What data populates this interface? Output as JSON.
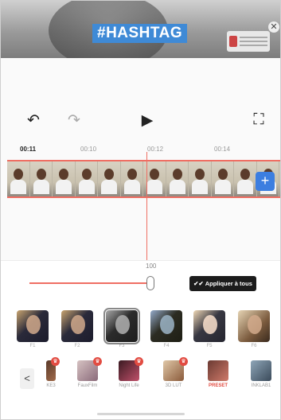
{
  "preview": {
    "hashtag": "#HASHTAG",
    "close_symbol": "✕"
  },
  "controls": {
    "undo": "↶",
    "redo": "↷",
    "play": "▶",
    "fullscreen": "⛶"
  },
  "timeline": {
    "current_time": "00:11",
    "ticks": [
      "00:10",
      "00:12",
      "00:14"
    ],
    "add_symbol": "+"
  },
  "filter_panel": {
    "intensity": "100",
    "apply_all_label": "Appliquer à tous",
    "filters": [
      {
        "label": "F1"
      },
      {
        "label": "F2"
      },
      {
        "label": "F3"
      },
      {
        "label": "F4"
      },
      {
        "label": "F5"
      },
      {
        "label": "F6"
      }
    ],
    "selected_filter": "F3",
    "back_symbol": "<",
    "categories": [
      {
        "label": "KE3",
        "premium": true
      },
      {
        "label": "FauxFilm",
        "premium": true
      },
      {
        "label": "Night Life",
        "premium": true
      },
      {
        "label": "3D LUT",
        "premium": true
      },
      {
        "label": "PRESET",
        "premium": false,
        "active": true
      },
      {
        "label": "INKLAB1",
        "premium": false
      }
    ]
  },
  "colors": {
    "accent": "#ef6e63",
    "add_button": "#3c7ee0",
    "apply_button_bg": "#1c1c1c"
  }
}
